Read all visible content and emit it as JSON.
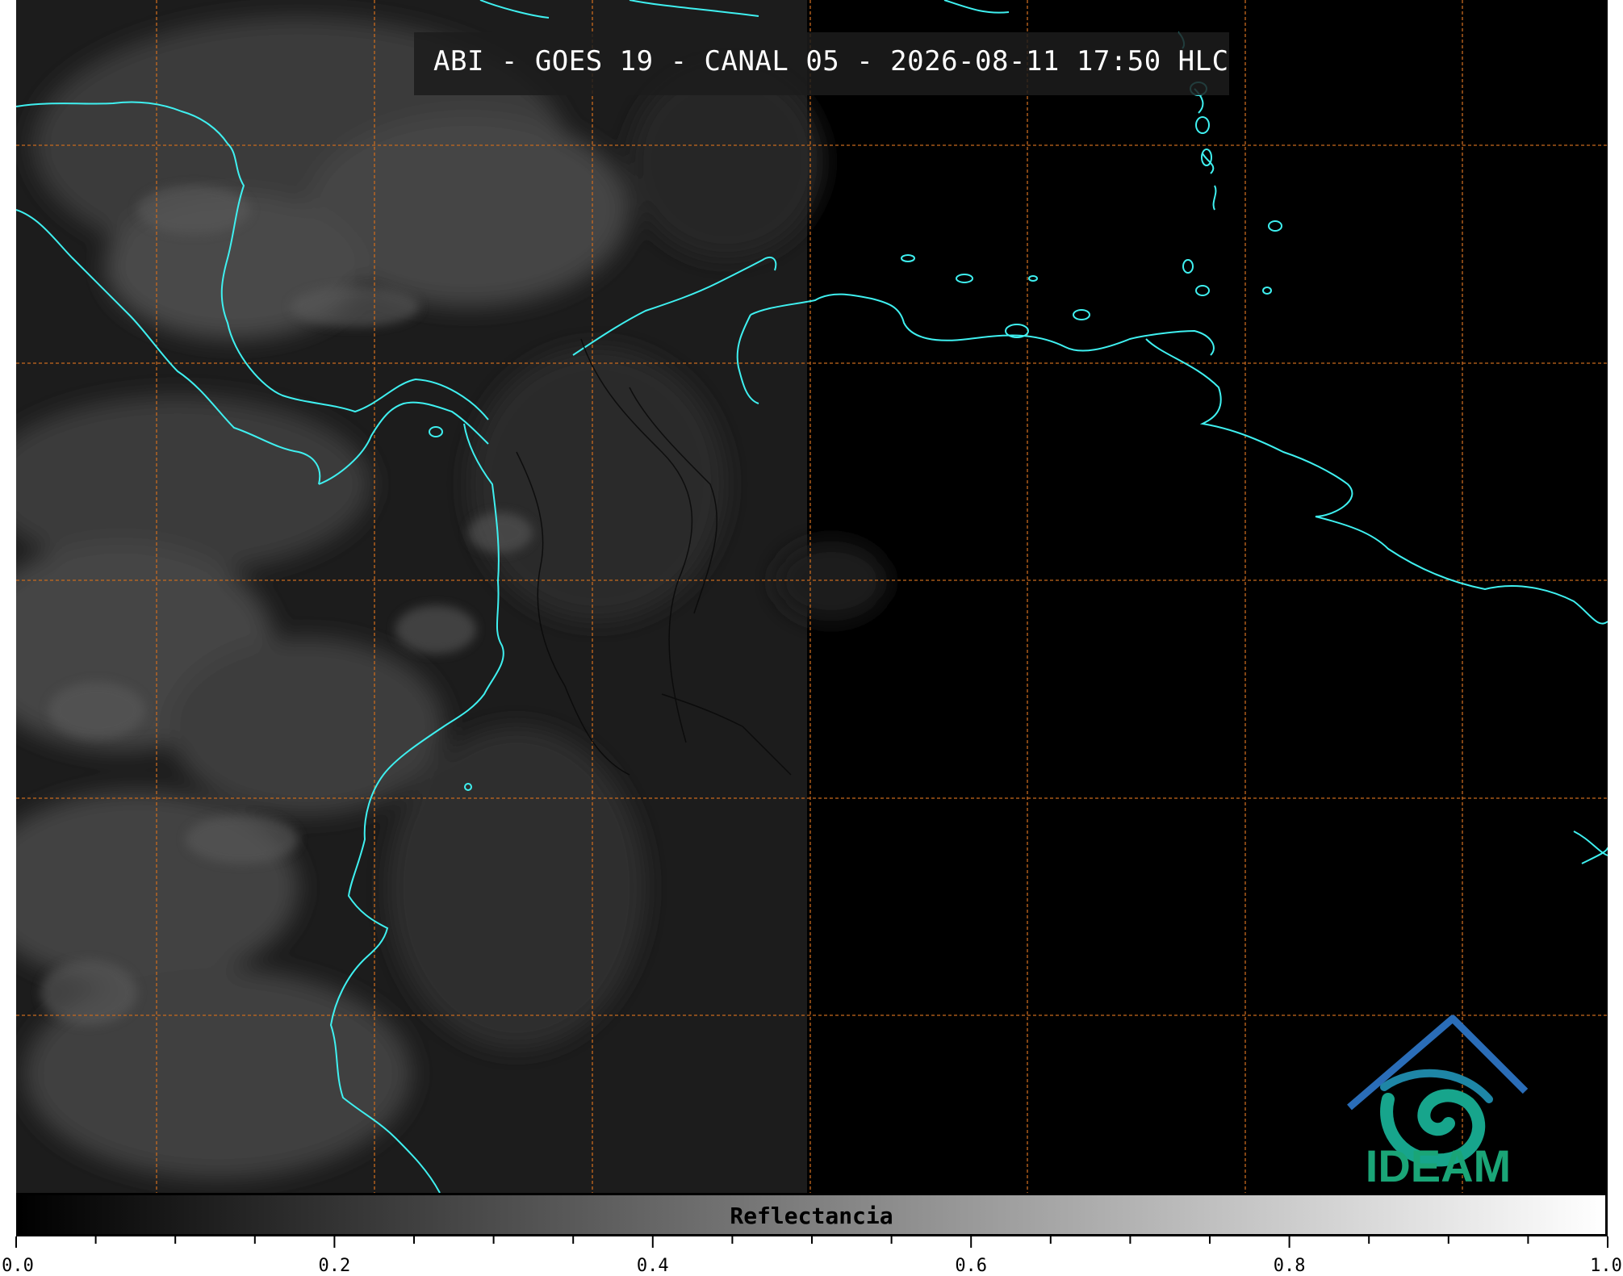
{
  "title": "ABI - GOES 19 - CANAL 05 - 2026-08-11 17:50 HLC",
  "logo": {
    "icon": "ideam-logo-icon",
    "text": "IDEAM",
    "colors": {
      "text": "#1aa577",
      "roof": "#2a6db8",
      "swirl": "#17a58c"
    }
  },
  "grid": {
    "line_color": "#c86a1e",
    "style": "dashed"
  },
  "coastline_color": "#3ff0f0",
  "colorbar": {
    "label": "Reflectancia",
    "min": 0.0,
    "max": 1.0,
    "tick_labels": [
      "0.0",
      "0.2",
      "0.4",
      "0.6",
      "0.8",
      "1.0"
    ],
    "tick_values": [
      0.0,
      0.2,
      0.4,
      0.6,
      0.8,
      1.0
    ],
    "minor_step": 0.05,
    "colors": {
      "low": "#000000",
      "high": "#ffffff"
    }
  }
}
